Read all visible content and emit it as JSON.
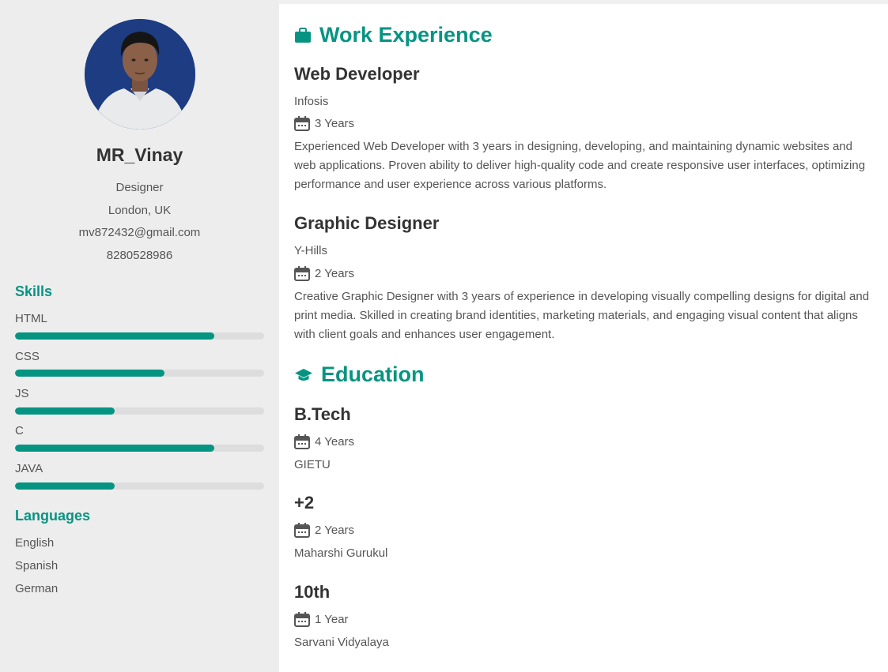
{
  "profile": {
    "name": "MR_Vinay",
    "role": "Designer",
    "location": "London, UK",
    "email": "mv872432@gmail.com",
    "phone": "8280528986"
  },
  "skills": {
    "heading": "Skills",
    "items": [
      {
        "label": "HTML",
        "level": 0.8
      },
      {
        "label": "CSS",
        "level": 0.6
      },
      {
        "label": "JS",
        "level": 0.4
      },
      {
        "label": "C",
        "level": 0.8
      },
      {
        "label": "JAVA",
        "level": 0.4
      }
    ]
  },
  "languages": {
    "heading": "Languages",
    "items": [
      "English",
      "Spanish",
      "German"
    ]
  },
  "work": {
    "heading": "Work Experience",
    "icon": "briefcase-icon",
    "items": [
      {
        "title": "Web Developer",
        "company": "Infosis",
        "duration": "3 Years",
        "description": "Experienced Web Developer with 3 years in designing, developing, and maintaining dynamic websites and web applications. Proven ability to deliver high-quality code and create responsive user interfaces, optimizing performance and user experience across various platforms."
      },
      {
        "title": "Graphic Designer",
        "company": "Y-Hills",
        "duration": "2 Years",
        "description": "Creative Graphic Designer with 3 years of experience in developing visually compelling designs for digital and print media. Skilled in creating brand identities, marketing materials, and engaging visual content that aligns with client goals and enhances user engagement."
      }
    ]
  },
  "education": {
    "heading": "Education",
    "icon": "graduation-cap-icon",
    "items": [
      {
        "degree": "B.Tech",
        "duration": "4 Years",
        "school": "GIETU"
      },
      {
        "degree": "+2",
        "duration": "2 Years",
        "school": "Maharshi Gurukul"
      },
      {
        "degree": "10th",
        "duration": "1 Year",
        "school": "Sarvani Vidyalaya"
      }
    ]
  },
  "colors": {
    "accent": "#069482",
    "sidebar_bg": "#ededed",
    "bar_track": "#dddddd"
  }
}
